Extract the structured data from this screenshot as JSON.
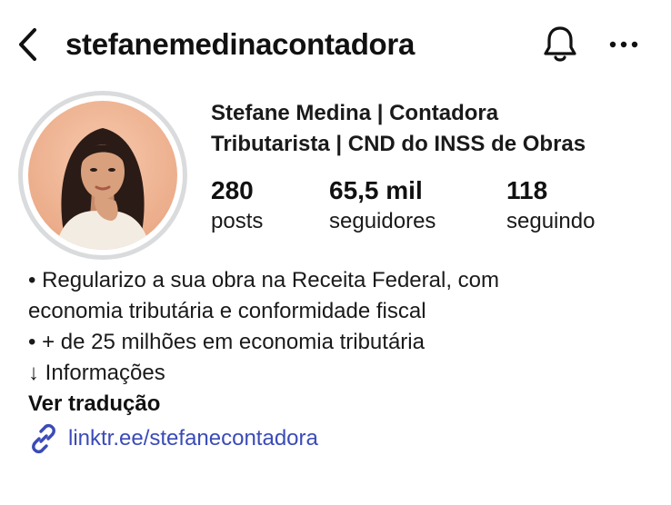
{
  "header": {
    "username": "stefanemedinacontadora"
  },
  "profile": {
    "name_line1": "Stefane Medina | Contadora",
    "name_line2": "Tributarista | CND do INSS de Obras"
  },
  "stats": {
    "posts": {
      "value": "280",
      "label": "posts"
    },
    "followers": {
      "value": "65,5 mil",
      "label": "seguidores"
    },
    "following": {
      "value": "118",
      "label": "seguindo"
    }
  },
  "bio": {
    "lines": [
      "• Regularizo a sua obra na Receita Federal, com",
      "economia tributária e conformidade fiscal",
      "• + de 25 milhões em economia tributária",
      "↓ Informações"
    ],
    "translate_label": "Ver tradução"
  },
  "link": {
    "text": "linktr.ee/stefanecontadora"
  },
  "icons": {
    "back": "chevron-left-icon",
    "bell": "bell-icon",
    "more": "more-horizontal-icon",
    "link": "link-icon"
  },
  "colors": {
    "link": "#3b4bb7",
    "ring": "#dadbdd",
    "text": "#111111"
  }
}
